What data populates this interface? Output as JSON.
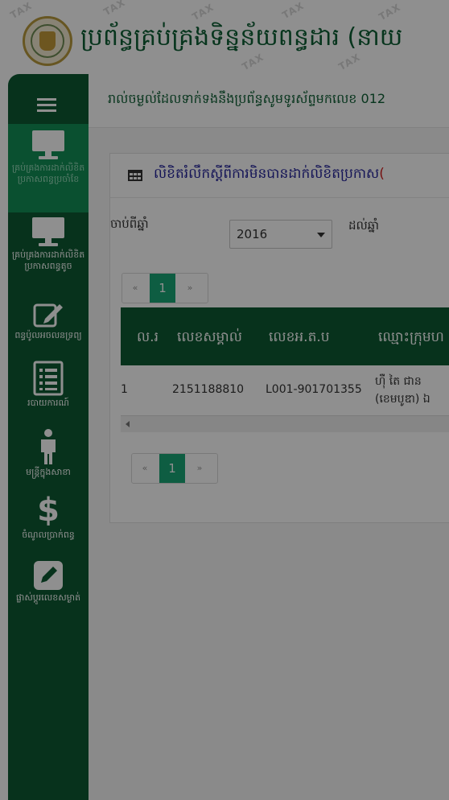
{
  "header": {
    "title": "ប្រព័ន្ធគ្រប់គ្រងទិន្នន័យពន្ធដារ (នាយ",
    "watermark": "TAX"
  },
  "sidebar": {
    "items": [
      {
        "label": "គ្រប់គ្រងការដាក់លិខិតប្រកាសពន្ធប្រចាំខែ",
        "icon": "monitor-icon",
        "active": true
      },
      {
        "label": "គ្រប់គ្រងការដាក់លិខិតប្រកាសពន្ធតូច",
        "icon": "monitor-icon",
        "active": false
      },
      {
        "label": "ពន្ធប៉ូលអចលនទ្រព្យ",
        "icon": "edit-icon",
        "active": false
      },
      {
        "label": "របាយការណ៍",
        "icon": "list-icon",
        "active": false
      },
      {
        "label": "មន្ត្រីក្នុងសាខា",
        "icon": "person-icon",
        "active": false
      },
      {
        "label": "ចំណូលប្រាក់ពន្ធ",
        "icon": "dollar-icon",
        "active": false
      },
      {
        "label": "ផ្លាស់ប្ដូរលេខសម្ងាត់",
        "icon": "pencil-square-icon",
        "active": false
      }
    ]
  },
  "notice": {
    "text": "រាល់ចម្ងល់ដែលទាក់ទងនឹងប្រព័ន្ធសូមទូរស័ព្ទមកលេខ 012"
  },
  "panel": {
    "title": "លិខិតរំលឹកស្ដីពីការមិនបានដាក់លិខិតប្រកាស",
    "title_suffix": "(",
    "filter_from_label": "ចាប់ពីឆ្នាំ",
    "year_selected": "2016",
    "filter_to_label": "ដល់ឆ្នាំ"
  },
  "pagination": {
    "prev": "«",
    "current": "1",
    "next": "»"
  },
  "table": {
    "headers": [
      "ល.រ",
      "លេខសម្គាល់",
      "លេខអ.ត.ប",
      "ឈ្មោះក្រុមហ"
    ],
    "rows": [
      {
        "no": "1",
        "id": "2151188810",
        "tin": "L001-901701355",
        "name_line1": "ហ៊ឺ តៃ ជាន",
        "name_line2": "(ខេមបូឌា) ឯ"
      }
    ]
  },
  "colors": {
    "sidebar": "#0d5a33",
    "active": "#138f57",
    "page_current": "#1aa676",
    "title_blue": "#22229a"
  }
}
